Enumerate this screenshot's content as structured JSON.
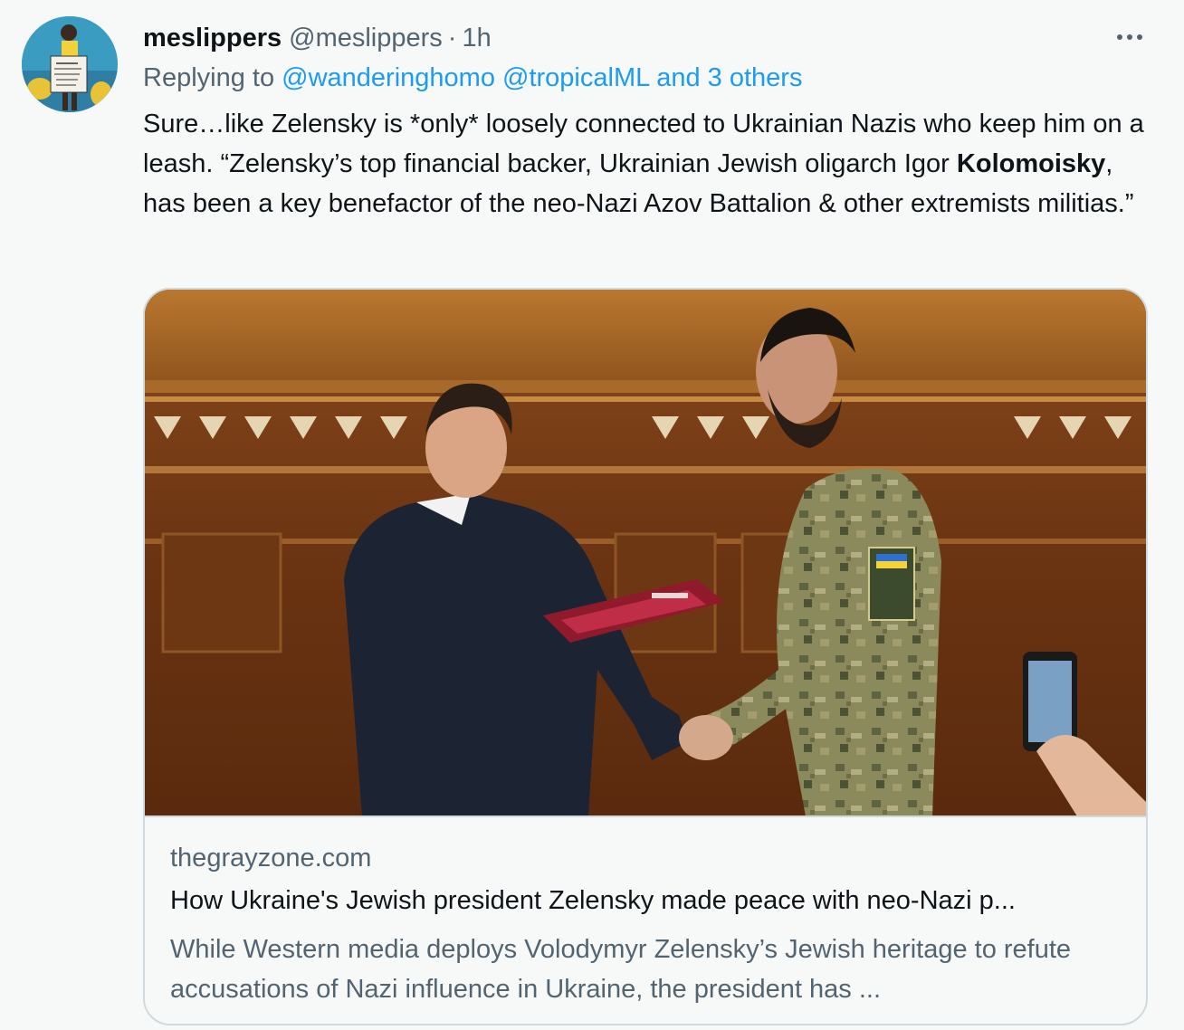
{
  "tweet": {
    "author_name": "meslippers",
    "author_handle": "@meslippers",
    "separator": "·",
    "time": "1h",
    "replying_prefix": "Replying to",
    "reply_to_1": "@wanderinghomo",
    "reply_to_2": "@tropicalML",
    "reply_others": "and 3 others",
    "text_part1": "Sure…like Zelensky is *only* loosely connected to Ukrainian Nazis who keep him on a leash. “Zelensky’s top financial backer, Ukrainian Jewish oligarch Igor ",
    "text_bold": "Kolomoisky",
    "text_part2": ", has been a key benefactor of the neo-Nazi Azov Battalion & other extremists militias.”"
  },
  "card": {
    "domain": "thegrayzone.com",
    "title": "How Ukraine's Jewish president Zelensky made peace with neo-Nazi p...",
    "description": "While Western media deploys Volodymyr Zelensky’s Jewish heritage to refute accusations of Nazi influence in Ukraine, the president has ..."
  },
  "icons": {
    "more": "more-options-icon",
    "avatar": "profile-avatar"
  },
  "colors": {
    "link": "#1d9bf0",
    "secondary_text": "#536471",
    "primary_text": "#0f1419",
    "background": "#f7f9f9",
    "border": "#cfd9de"
  }
}
